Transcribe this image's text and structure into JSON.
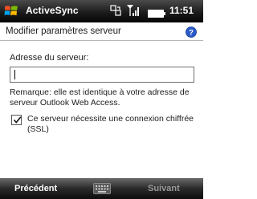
{
  "status_bar": {
    "app_title": "ActiveSync",
    "time": "11:51",
    "icons": [
      "windows-start-icon",
      "sync-connection-icon",
      "signal-strength-icon",
      "battery-icon"
    ]
  },
  "header": {
    "title": "Modifier paramètres serveur",
    "help_icon": "help-icon"
  },
  "form": {
    "server_label": "Adresse du serveur:",
    "server_value": "",
    "remark": "Remarque: elle est identique à votre adresse de serveur Outlook Web Access.",
    "ssl_checkbox_checked": true,
    "ssl_label": "Ce serveur nécessite une connexion chiffrée (SSL)"
  },
  "softkeys": {
    "left": "Précédent",
    "right": "Suivant",
    "center_icon": "keyboard-icon"
  },
  "colors": {
    "bar_dark": "#1c1c1c",
    "help_blue": "#2a5bc8",
    "disabled_text": "#9a9a9a"
  }
}
